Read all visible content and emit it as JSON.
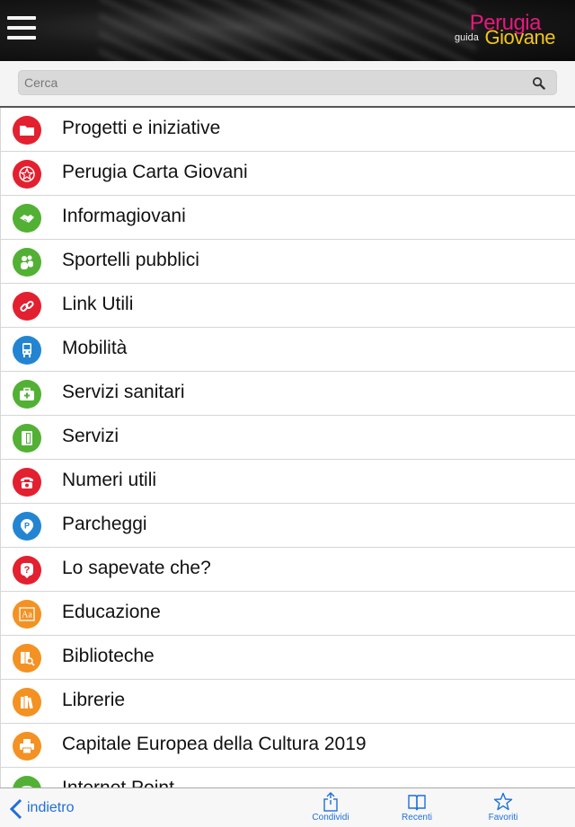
{
  "app": {
    "logo": {
      "line1": "Perugia",
      "line2": "guida",
      "line3": "Giovane"
    }
  },
  "search": {
    "placeholder": "Cerca"
  },
  "list": [
    {
      "label": "Progetti e iniziative",
      "color": "#e3202f",
      "icon": "folder-icon"
    },
    {
      "label": "Perugia Carta Giovani",
      "color": "#e3202f",
      "icon": "star-badge-icon"
    },
    {
      "label": "Informagiovani",
      "color": "#52b134",
      "icon": "handshake-icon"
    },
    {
      "label": "Sportelli pubblici",
      "color": "#52b134",
      "icon": "people-icon"
    },
    {
      "label": "Link Utili",
      "color": "#e3202f",
      "icon": "link-icon"
    },
    {
      "label": "Mobilità",
      "color": "#2385d2",
      "icon": "bus-icon"
    },
    {
      "label": "Servizi sanitari",
      "color": "#52b134",
      "icon": "medical-kit-icon"
    },
    {
      "label": "Servizi",
      "color": "#52b134",
      "icon": "document-icon"
    },
    {
      "label": "Numeri utili",
      "color": "#e3202f",
      "icon": "phone-icon"
    },
    {
      "label": "Parcheggi",
      "color": "#2385d2",
      "icon": "parking-icon"
    },
    {
      "label": "Lo sapevate che?",
      "color": "#e3202f",
      "icon": "question-icon"
    },
    {
      "label": "Educazione",
      "color": "#f39223",
      "icon": "dictionary-icon"
    },
    {
      "label": "Biblioteche",
      "color": "#f39223",
      "icon": "library-search-icon"
    },
    {
      "label": "Librerie",
      "color": "#f39223",
      "icon": "books-icon"
    },
    {
      "label": "Capitale Europea della Cultura 2019",
      "color": "#f39223",
      "icon": "printer-icon"
    },
    {
      "label": "Internet Point",
      "color": "#52b134",
      "icon": "wifi-icon"
    }
  ],
  "footer": {
    "back": "indietro",
    "share": "Condividi",
    "recent": "Recenti",
    "favorites": "Favoriti",
    "accent": "#1e6fd9"
  }
}
